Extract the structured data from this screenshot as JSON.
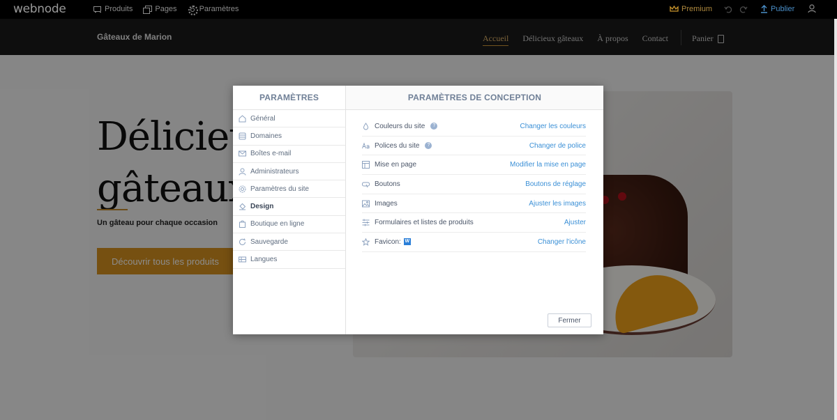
{
  "editor": {
    "logo": "webnode",
    "nav": [
      {
        "label": "Produits",
        "icon": "cart-icon"
      },
      {
        "label": "Pages",
        "icon": "pages-icon"
      },
      {
        "label": "Paramètres",
        "icon": "gear-icon"
      }
    ],
    "premium_label": "Premium",
    "undo_icon": "undo-icon",
    "redo_icon": "redo-icon",
    "publish_label": "Publier",
    "accent": "#4a8fc9"
  },
  "site": {
    "name": "Gâteaux de Marion",
    "nav": [
      "Accueil",
      "Délicieux gâteaux",
      "À propos",
      "Contact"
    ],
    "active_nav": "Accueil",
    "cart_label": "Panier"
  },
  "hero": {
    "title_line1": "Délicieu",
    "title_line2": "gâteaux",
    "subtitle": "Un gâteau pour chaque occasion",
    "cta": "Découvrir tous les produits",
    "accent": "#d8931f"
  },
  "modal": {
    "sidebar_title": "PARAMÈTRES",
    "sidebar_items": [
      {
        "label": "Général",
        "icon": "home-icon",
        "active": false
      },
      {
        "label": "Domaines",
        "icon": "database-icon",
        "active": false
      },
      {
        "label": "Boîtes e-mail",
        "icon": "mail-icon",
        "active": false
      },
      {
        "label": "Administrateurs",
        "icon": "users-icon",
        "active": false
      },
      {
        "label": "Paramètres du site",
        "icon": "gear-icon",
        "active": false
      },
      {
        "label": "Design",
        "icon": "paint-bucket-icon",
        "active": true
      },
      {
        "label": "Boutique en ligne",
        "icon": "shopping-bag-icon",
        "active": false
      },
      {
        "label": "Sauvegarde",
        "icon": "backup-icon",
        "active": false
      },
      {
        "label": "Langues",
        "icon": "flag-icon",
        "active": false
      }
    ],
    "main_title": "PARAMÈTRES DE CONCEPTION",
    "rows": [
      {
        "label": "Couleurs du site",
        "icon": "droplet-icon",
        "help": true,
        "action": "Changer les couleurs"
      },
      {
        "label": "Polices du site",
        "icon": "font-icon",
        "help": true,
        "action": "Changer de police"
      },
      {
        "label": "Mise en page",
        "icon": "layout-icon",
        "help": false,
        "action": "Modifier la mise en page"
      },
      {
        "label": "Boutons",
        "icon": "button-icon",
        "help": false,
        "action": "Boutons de réglage"
      },
      {
        "label": "Images",
        "icon": "image-icon",
        "help": false,
        "action": "Ajuster les images"
      },
      {
        "label": "Formulaires et listes de produits",
        "icon": "sliders-icon",
        "help": false,
        "action": "Ajuster"
      },
      {
        "label": "Favicon:",
        "icon": "star-icon",
        "help": false,
        "favicon": "W",
        "action": "Changer l'icône"
      }
    ],
    "help_glyph": "?",
    "close_label": "Fermer",
    "link_color": "#3a8fd6",
    "heading_color": "#6f7f96"
  }
}
